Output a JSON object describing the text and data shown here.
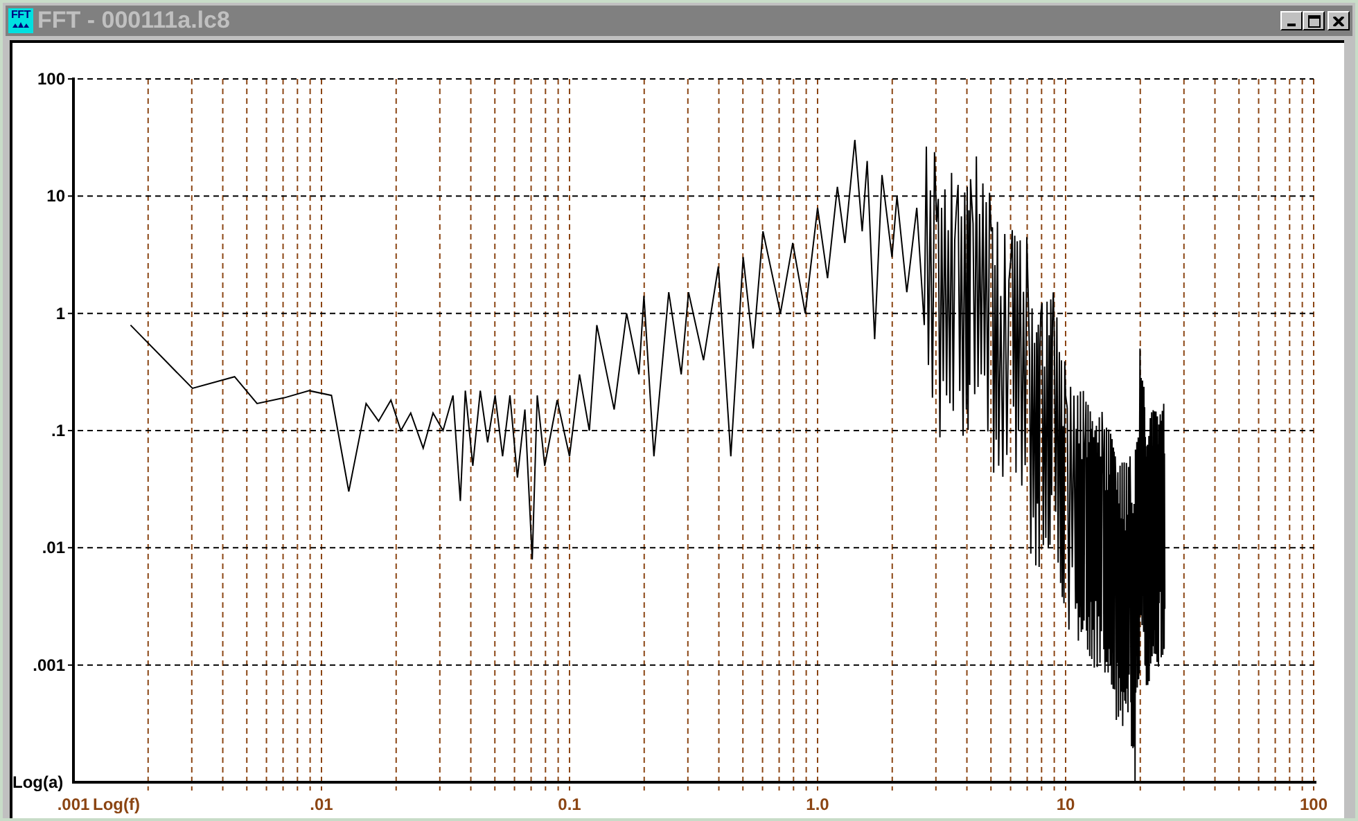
{
  "window": {
    "icon_text": "FFT",
    "title": "FFT - 000111a.lc8",
    "buttons": [
      {
        "kind": "minimize"
      },
      {
        "kind": "maximize"
      },
      {
        "kind": "close"
      }
    ]
  },
  "chart": {
    "kind": "picture",
    "y_axis_title": "Log(a)",
    "x_axis_title": "Log(f)",
    "y_axis_labels": [
      "100",
      "10",
      "1",
      ".1",
      ".01",
      ".001"
    ],
    "x_axis_labels": [
      ".001",
      ".01",
      "0.1",
      "1.0",
      "10",
      "100"
    ]
  }
}
